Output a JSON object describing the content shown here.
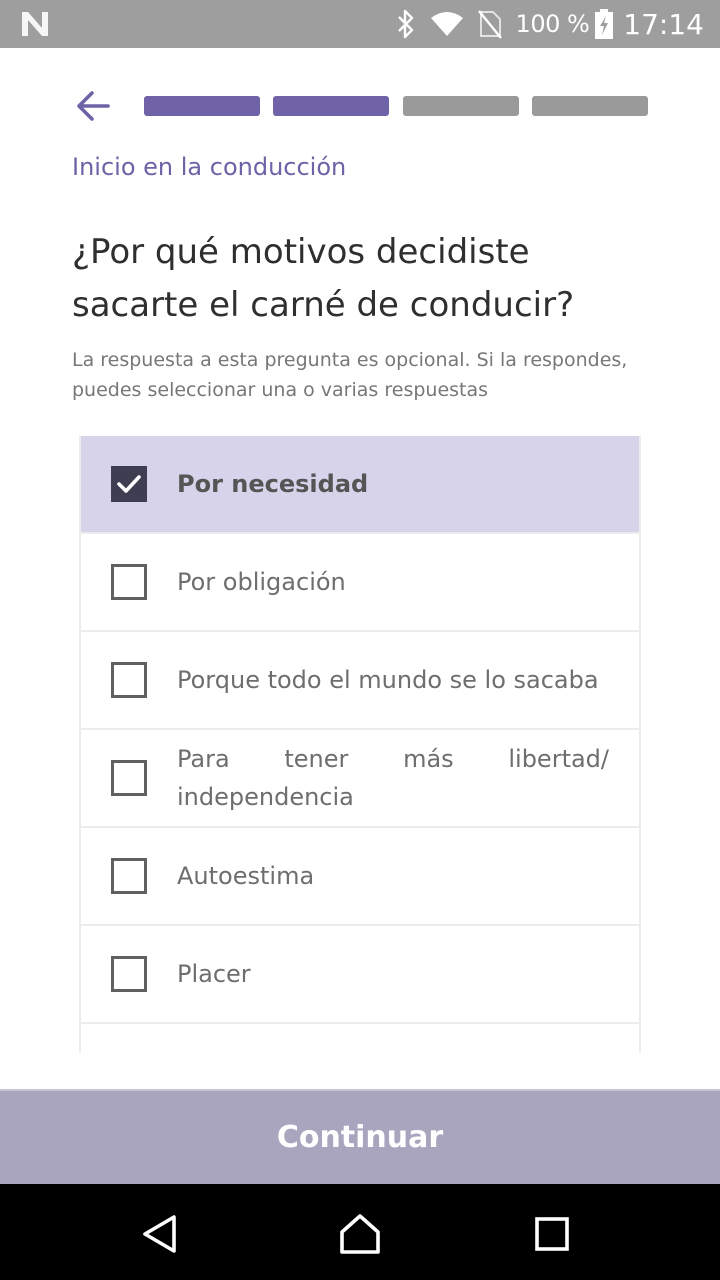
{
  "status_bar": {
    "battery_percent": "100 %",
    "time": "17:14",
    "icons": [
      "app-notification-icon",
      "bluetooth-icon",
      "wifi-icon",
      "no-sim-icon",
      "battery-charging-icon"
    ]
  },
  "header": {
    "back_icon": "arrow-left-icon",
    "progress": {
      "total_steps": 4,
      "completed_steps": 2
    },
    "section_title": "Inicio en la conducción"
  },
  "question": {
    "title": "¿Por qué motivos decidiste sacarte el carné de conducir?",
    "hint": "La respuesta a esta pregunta es opcional. Si la respondes, puedes seleccionar una o varias respuestas"
  },
  "options": [
    {
      "label": "Por necesidad",
      "checked": true
    },
    {
      "label": "Por obligación",
      "checked": false
    },
    {
      "label": "Porque todo el mundo se lo sacaba",
      "checked": false
    },
    {
      "label": "Para tener más libertad/ independencia",
      "checked": false
    },
    {
      "label": "Autoestima",
      "checked": false
    },
    {
      "label": "Placer",
      "checked": false
    }
  ],
  "footer": {
    "continue_label": "Continuar"
  },
  "nav_bar": {
    "icons": [
      "nav-back-icon",
      "nav-home-icon",
      "nav-recents-icon"
    ]
  },
  "colors": {
    "accent": "#6f62a6",
    "progress_active": "#6f62a6",
    "progress_inactive": "#9a9a9a",
    "selected_row": "#d7d3ea",
    "continue_bg": "#a9a5be"
  }
}
